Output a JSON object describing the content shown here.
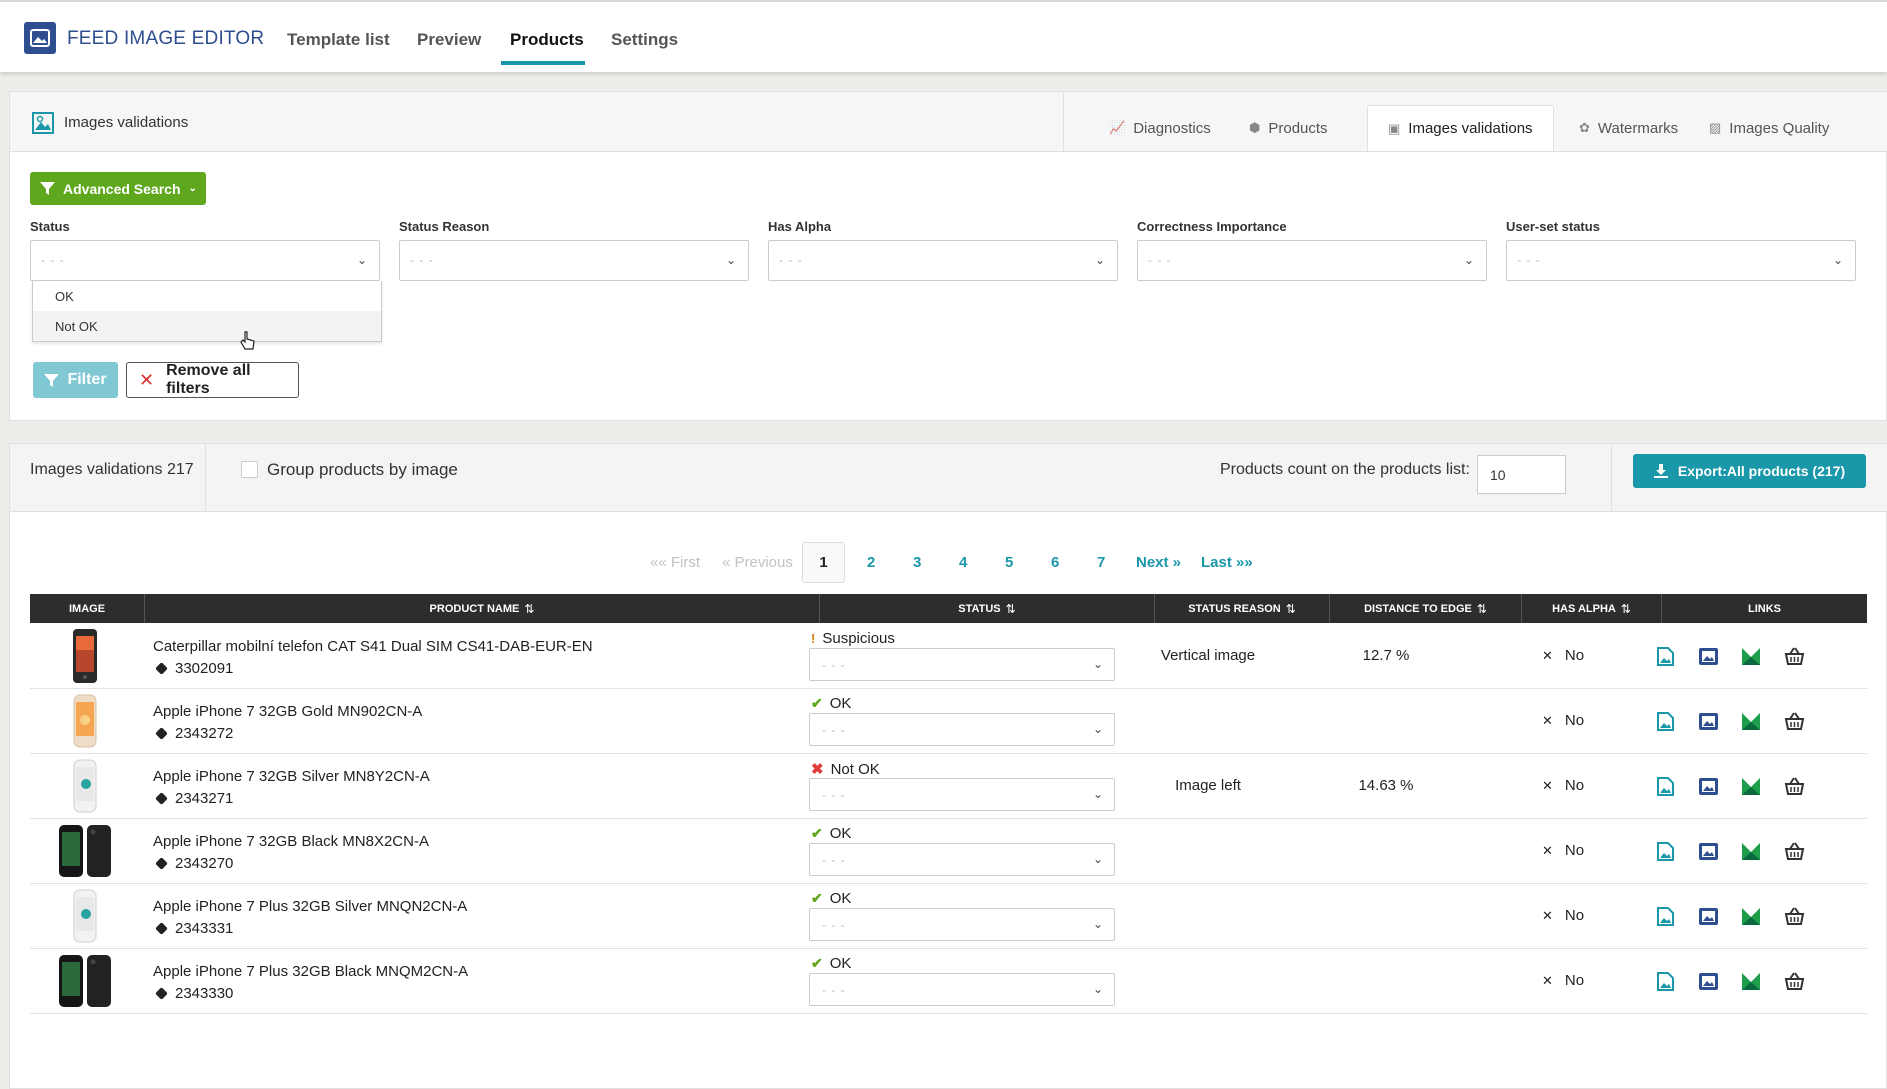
{
  "app": {
    "title": "FEED IMAGE EDITOR"
  },
  "nav": {
    "tabs": [
      "Template list",
      "Preview",
      "Products",
      "Settings"
    ],
    "active": "Products"
  },
  "section": {
    "title": "Images validations",
    "subtabs": [
      "Diagnostics",
      "Products",
      "Images validations",
      "Watermarks",
      "Images Quality"
    ],
    "active_subtab": "Images validations"
  },
  "filters": {
    "advanced_search": "Advanced Search",
    "fields": [
      {
        "label": "Status",
        "placeholder": "- - -"
      },
      {
        "label": "Status Reason",
        "placeholder": "- - -"
      },
      {
        "label": "Has Alpha",
        "placeholder": "- - -"
      },
      {
        "label": "Correctness Importance",
        "placeholder": "- - -"
      },
      {
        "label": "User-set status",
        "placeholder": "- - -"
      }
    ],
    "status_options": [
      "OK",
      "Not OK"
    ],
    "hovered_option": "Not OK",
    "filter_btn": "Filter",
    "remove_btn": "Remove all filters"
  },
  "results": {
    "count_label": "Images validations 217",
    "group_label": "Group products by image",
    "group_checked": false,
    "products_count_label": "Products count on the products list:",
    "products_count_value": "10",
    "export_label": "Export:All products (217)"
  },
  "pagination": {
    "first": "«« First",
    "previous": "« Previous",
    "pages": [
      "1",
      "2",
      "3",
      "4",
      "5",
      "6",
      "7"
    ],
    "current": "1",
    "next": "Next »",
    "last": "Last »»"
  },
  "table": {
    "columns": [
      "IMAGE",
      "PRODUCT NAME",
      "STATUS",
      "STATUS REASON",
      "DISTANCE TO EDGE",
      "HAS ALPHA",
      "LINKS"
    ],
    "rows": [
      {
        "name": "Caterpillar mobilní telefon CAT S41 Dual SIM CS41-DAB-EUR-EN",
        "sku": "3302091",
        "status": "Suspicious",
        "status_icon": "warning-icon",
        "user_status": "- - -",
        "reason": "Vertical image",
        "distance": "12.7 %",
        "alpha": "No",
        "thumb": "cat-phone"
      },
      {
        "name": "Apple iPhone 7 32GB Gold MN902CN-A",
        "sku": "2343272",
        "status": "OK",
        "status_icon": "check-icon",
        "user_status": "- - -",
        "reason": "",
        "distance": "",
        "alpha": "No",
        "thumb": "iphone-gold"
      },
      {
        "name": "Apple iPhone 7 32GB Silver MN8Y2CN-A",
        "sku": "2343271",
        "status": "Not OK",
        "status_icon": "cross-icon",
        "user_status": "- - -",
        "reason": "Image left",
        "distance": "14.63 %",
        "alpha": "No",
        "thumb": "iphone-silver"
      },
      {
        "name": "Apple iPhone 7 32GB Black MN8X2CN-A",
        "sku": "2343270",
        "status": "OK",
        "status_icon": "check-icon",
        "user_status": "- - -",
        "reason": "",
        "distance": "",
        "alpha": "No",
        "thumb": "iphone-black"
      },
      {
        "name": "Apple iPhone 7 Plus 32GB Silver MNQN2CN-A",
        "sku": "2343331",
        "status": "OK",
        "status_icon": "check-icon",
        "user_status": "- - -",
        "reason": "",
        "distance": "",
        "alpha": "No",
        "thumb": "iphone-silver"
      },
      {
        "name": "Apple iPhone 7 Plus 32GB Black MNQM2CN-A",
        "sku": "2343330",
        "status": "OK",
        "status_icon": "check-icon",
        "user_status": "- - -",
        "reason": "",
        "distance": "",
        "alpha": "No",
        "thumb": "iphone-black"
      }
    ]
  },
  "colors": {
    "brand": "#2f4e8f",
    "accent": "#1a97a9",
    "green": "#5fa81e",
    "danger": "#e03c3c"
  }
}
